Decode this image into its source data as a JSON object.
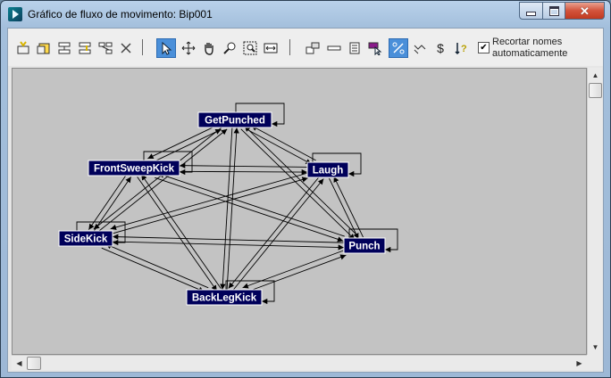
{
  "window": {
    "title": "Gráfico de fluxo de movimento: Bip001"
  },
  "toolbar": {
    "icons": [
      "create-clip-icon",
      "create-multiple-clips-icon",
      "create-transition-icon",
      "create-transition-from-to-icon",
      "create-random-transitions-icon",
      "delete-icon",
      "select-icon",
      "move-icon",
      "pan-icon",
      "zoom-icon",
      "zoom-region-icon",
      "zoom-extents-icon",
      "show-scripts-icon",
      "optimize-transitions-icon",
      "assign-file-icon",
      "set-start-icon",
      "percent-icon",
      "random-start-icon",
      "randomize-icon",
      "compute-icon"
    ],
    "crop_names_label": "Recortar nomes automaticamente",
    "crop_names_checked": true
  },
  "graph": {
    "node_fill": "#00005a",
    "node_text": "#ffffff",
    "nodes": [
      {
        "id": "getpunched",
        "label": "GetPunched"
      },
      {
        "id": "frontsweepkick",
        "label": "FrontSweepKick"
      },
      {
        "id": "laugh",
        "label": "Laugh"
      },
      {
        "id": "sidekick",
        "label": "SideKick"
      },
      {
        "id": "punch",
        "label": "Punch"
      },
      {
        "id": "backlegkick",
        "label": "BackLegKick"
      }
    ]
  }
}
